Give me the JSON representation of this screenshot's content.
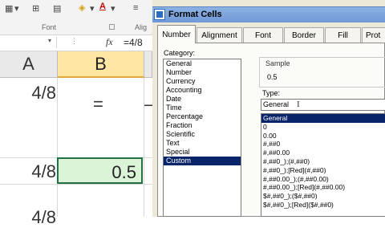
{
  "excel": {
    "ribbon": {
      "font_group_label": "Font",
      "alignment_group_label_partial": "Alig"
    },
    "formula_bar": {
      "fx_symbol": "fx",
      "content": "=4/8"
    },
    "columns": [
      "A",
      "B"
    ],
    "cells": {
      "a1": "4/8",
      "b1_equals": "=",
      "c1_partial": "–",
      "a2": "4/8",
      "b2": "0.5",
      "a3_partial": "4/8"
    }
  },
  "dialog": {
    "title": "Format Cells",
    "tabs": [
      "Number",
      "Alignment",
      "Font",
      "Border",
      "Fill",
      "Prot"
    ],
    "active_tab": "Number",
    "category_label": "Category:",
    "categories": [
      "General",
      "Number",
      "Currency",
      "Accounting",
      "Date",
      "Time",
      "Percentage",
      "Fraction",
      "Scientific",
      "Text",
      "Special",
      "Custom"
    ],
    "selected_category": "Custom",
    "sample_label": "Sample",
    "sample_value": "0.5",
    "type_label": "Type:",
    "type_value": "General",
    "type_list": [
      "General",
      "0",
      "0.00",
      "#,##0",
      "#,##0.00",
      "#,##0_);(#,##0)",
      "#,##0_);[Red](#,##0)",
      "#,##0.00_);(#,##0.00)",
      "#,##0.00_);[Red](#,##0.00)",
      "$#,##0_);($#,##0)",
      "$#,##0_);[Red]($#,##0)"
    ],
    "selected_type": "General"
  },
  "colors": {
    "selected_col_header": "#ffe6a3",
    "selected_cell_fill": "#dbf3d6",
    "selection_border": "#217346",
    "list_highlight": "#0a246a",
    "dialog_bg": "#ece9d8"
  }
}
